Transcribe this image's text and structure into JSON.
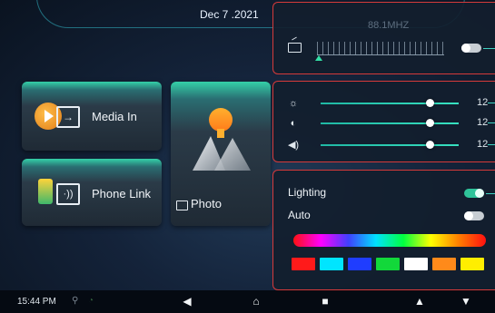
{
  "header": {
    "date": "Dec 7 .2021"
  },
  "tiles": {
    "media_in": {
      "label": "Media In"
    },
    "phone_link": {
      "label": "Phone Link"
    },
    "photo": {
      "label": "Photo"
    }
  },
  "radio": {
    "frequency": "88.1MHZ",
    "toggle_state": "off"
  },
  "sliders": [
    {
      "icon": "brightness-icon",
      "value": "12",
      "level": 0.79
    },
    {
      "icon": "contrast-icon",
      "value": "12",
      "level": 0.79
    },
    {
      "icon": "volume-icon",
      "value": "12",
      "level": 0.79
    }
  ],
  "lighting": {
    "lighting_label": "Lighting",
    "lighting_state": "on",
    "auto_label": "Auto",
    "auto_state": "off",
    "swatches": [
      "#ff1a1a",
      "#00e5ff",
      "#1f3dff",
      "#12d83a",
      "#ffffff",
      "#ff8a1a",
      "#ffee00"
    ]
  },
  "status_bar": {
    "time": "15:44 PM"
  },
  "nav": {
    "back": "◀",
    "home": "⌂",
    "recents": "■",
    "up": "▲",
    "down": "▼"
  },
  "colors": {
    "accent": "#2fc39a",
    "panel_border": "#d53a3a"
  }
}
